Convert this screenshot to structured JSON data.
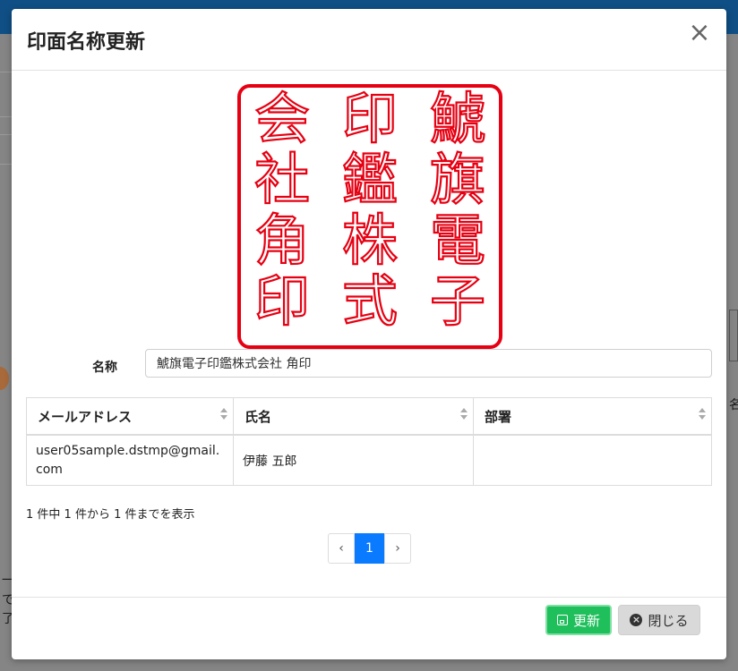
{
  "background": {
    "partial_text_right": "名",
    "partial_text_left_1": "一",
    "partial_text_left_2": "で",
    "partial_text_left_3": "了"
  },
  "modal": {
    "title": "印面名称更新",
    "close_symbol": "×",
    "seal": {
      "color": "#e60012",
      "columns": [
        [
          "鯱",
          "旗",
          "電",
          "子"
        ],
        [
          "印",
          "鑑",
          "株",
          "式"
        ],
        [
          "会",
          "社",
          "角",
          "印"
        ]
      ]
    },
    "name_label": "名称",
    "name_value": "鯱旗電子印鑑株式会社 角印",
    "table": {
      "headers": [
        "メールアドレス",
        "氏名",
        "部署"
      ],
      "rows": [
        {
          "email": "user05sample.dstmp@gmail.com",
          "name": "伊藤 五郎",
          "department": ""
        }
      ]
    },
    "info": "1 件中 1 件から 1 件までを表示",
    "pagination": {
      "prev": "‹",
      "current": "1",
      "next": "›"
    },
    "buttons": {
      "update": "更新",
      "close": "閉じる"
    },
    "colors": {
      "update": "#1fbf5c",
      "page_active": "#0a7bff",
      "topbar": "#0f4f85"
    }
  }
}
